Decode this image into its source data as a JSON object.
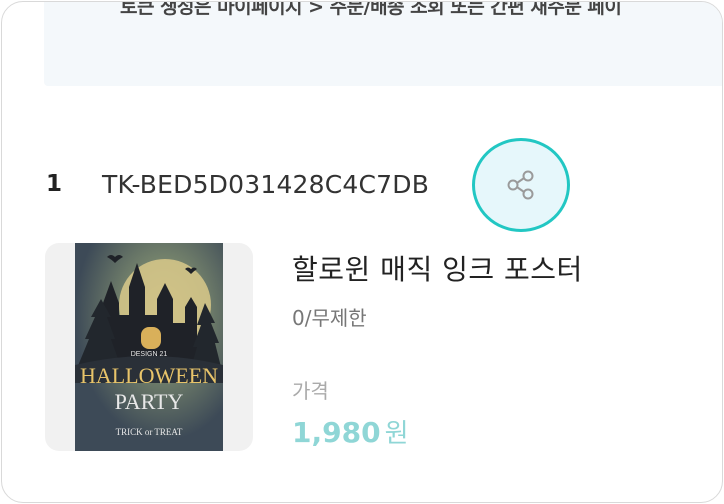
{
  "notice": {
    "text": "토큰 생성은 마이페이지 > 주문/배송 조회 또는 간편 재주문 페이"
  },
  "token": {
    "index": "1",
    "code": "TK-BED5D031428C4C7DB"
  },
  "share": {
    "icon": "share-icon"
  },
  "product": {
    "name": "할로윈 매직 잉크 포스터",
    "stock": "0/무제한",
    "price_label": "가격",
    "price": "1,980",
    "price_unit": "원",
    "poster": {
      "header": "DESIGN 21",
      "title": "HALLOWEEN",
      "subtitle": "PARTY",
      "tagline": "TRICK or TREAT"
    }
  },
  "colors": {
    "accent": "#22c7c3",
    "price": "#8fd6d6",
    "poster_bg": "#3d4a57",
    "poster_moon": "#d9c98a"
  }
}
